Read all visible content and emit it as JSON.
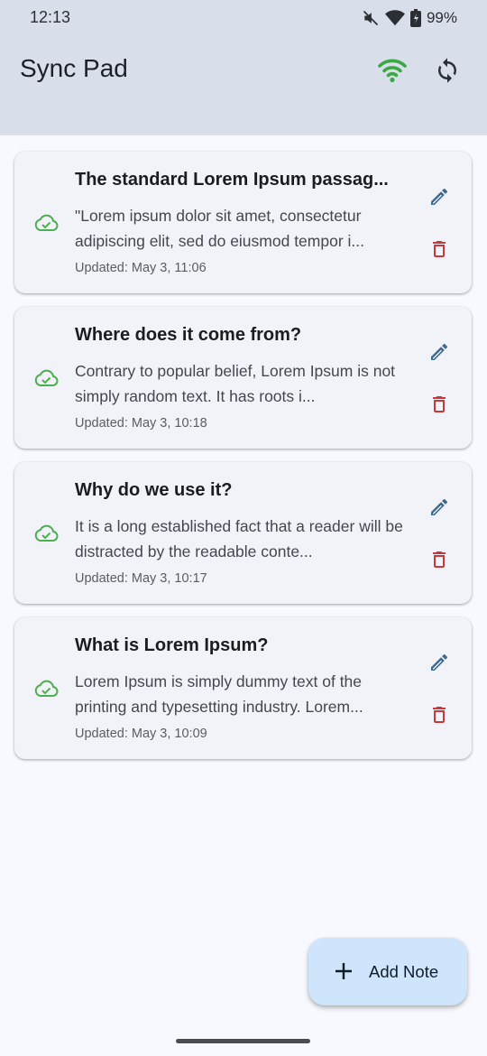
{
  "status_bar": {
    "time": "12:13",
    "battery": "99%",
    "icons": [
      "mute-icon",
      "wifi-signal-icon",
      "battery-charging-icon"
    ]
  },
  "app_bar": {
    "title": "Sync Pad",
    "actions": [
      {
        "icon": "wifi-icon",
        "color": "#3aa843"
      },
      {
        "icon": "sync-icon",
        "color": "#2b2e33"
      }
    ]
  },
  "notes": [
    {
      "title": "The standard Lorem Ipsum passag...",
      "body": "\"Lorem ipsum dolor sit amet, consectetur adipiscing elit, sed do eiusmod tempor i...",
      "updated": "Updated: May 3, 11:06",
      "status_icon": "cloud-done-icon"
    },
    {
      "title": "Where does it come from?",
      "body": "Contrary to popular belief, Lorem Ipsum is not simply random text. It has roots i...",
      "updated": "Updated: May 3, 10:18",
      "status_icon": "cloud-done-icon"
    },
    {
      "title": "Why do we use it?",
      "body": "It is a long established fact that a reader will be distracted by the readable conte...",
      "updated": "Updated: May 3, 10:17",
      "status_icon": "cloud-done-icon"
    },
    {
      "title": "What is Lorem Ipsum?",
      "body": "Lorem Ipsum is simply dummy text of the printing and typesetting industry. Lorem...",
      "updated": "Updated: May 3, 10:09",
      "status_icon": "cloud-done-icon"
    }
  ],
  "fab": {
    "label": "Add Note",
    "icon": "plus-icon"
  },
  "colors": {
    "header_bg": "#d8dfea",
    "page_bg": "#f8f9fe",
    "card_bg": "#f1f3f8",
    "synced_green": "#3aa843",
    "cloud_green": "#4caf50",
    "edit_blue": "#3a6a8e",
    "delete_red": "#c8383a",
    "fab_bg": "#cfe5fb"
  }
}
